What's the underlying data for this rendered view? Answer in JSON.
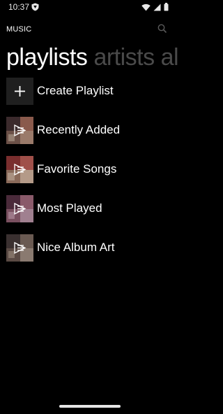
{
  "status_bar": {
    "time": "10:37"
  },
  "app": {
    "title": "MUSIC"
  },
  "pivot": {
    "items": [
      "playlists",
      "artists",
      "alb"
    ]
  },
  "playlists": {
    "create_label": "Create Playlist",
    "items": [
      {
        "label": "Recently Added"
      },
      {
        "label": "Favorite Songs"
      },
      {
        "label": "Most Played"
      },
      {
        "label": "Nice Album Art"
      }
    ]
  },
  "colors": {
    "background": "#000000",
    "text": "#ffffff",
    "inactive_pivot": "#4a4a4a",
    "create_tile": "#1f1f1f"
  }
}
